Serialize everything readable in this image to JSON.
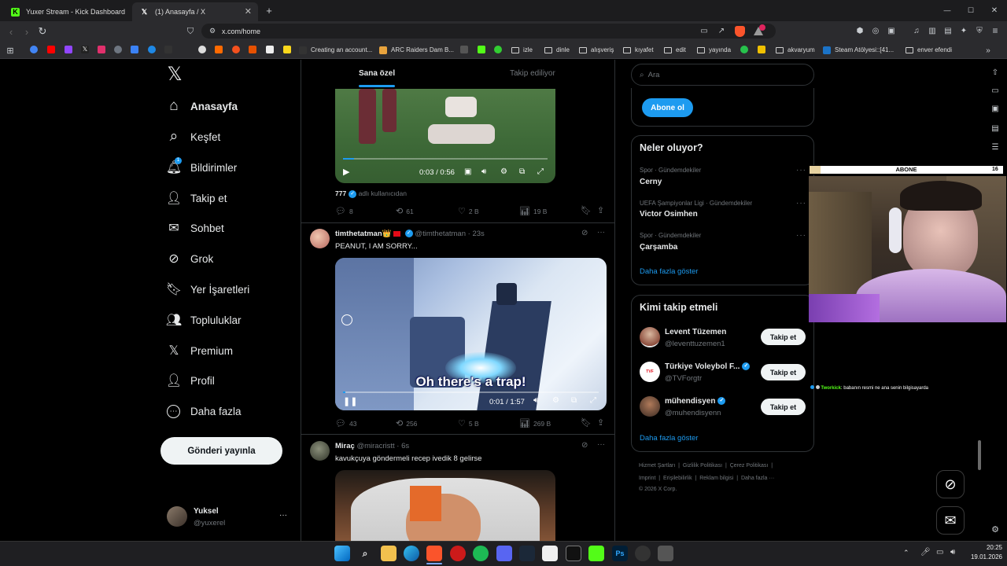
{
  "browser": {
    "tabs": [
      {
        "title": "Yuxer Stream - Kick Dashboard",
        "icon": "kick-icon",
        "color": "#53fc18"
      },
      {
        "title": "(1) Anasayfa / X",
        "icon": "x-logo-icon",
        "color": "#ffffff"
      }
    ],
    "new_tab": "+",
    "url": "x.com/home",
    "bookmarks": [
      {
        "label": "Creating an account...",
        "type": "page"
      },
      {
        "label": "ARC Raiders Dam B...",
        "type": "page"
      },
      {
        "label": "izle",
        "type": "folder"
      },
      {
        "label": "dinle",
        "type": "folder"
      },
      {
        "label": "alışveriş",
        "type": "folder"
      },
      {
        "label": "kıyafet",
        "type": "folder"
      },
      {
        "label": "edit",
        "type": "folder"
      },
      {
        "label": "yayında",
        "type": "folder"
      },
      {
        "label": "akvaryum",
        "type": "folder"
      },
      {
        "label": "Steam Atölyesi::[41...",
        "type": "page"
      },
      {
        "label": "enver efendi",
        "type": "folder"
      }
    ],
    "window_controls": [
      "—",
      "☐",
      "✕"
    ]
  },
  "sidebar": {
    "logo": "𝕏",
    "items": [
      {
        "label": "Anasayfa",
        "icon": "home-icon",
        "glyph": "⌂",
        "active": true
      },
      {
        "label": "Keşfet",
        "icon": "search-icon",
        "glyph": "⌕"
      },
      {
        "label": "Bildirimler",
        "icon": "bell-icon",
        "glyph": "🔔︎",
        "badge": "1"
      },
      {
        "label": "Takip et",
        "icon": "follow-icon",
        "glyph": "👤︎"
      },
      {
        "label": "Sohbet",
        "icon": "mail-icon",
        "glyph": "✉"
      },
      {
        "label": "Grok",
        "icon": "grok-icon",
        "glyph": "⊘"
      },
      {
        "label": "Yer İşaretleri",
        "icon": "bookmark-icon",
        "glyph": "🔖︎"
      },
      {
        "label": "Topluluklar",
        "icon": "communities-icon",
        "glyph": "👥︎"
      },
      {
        "label": "Premium",
        "icon": "premium-x-icon",
        "glyph": "𝕏"
      },
      {
        "label": "Profil",
        "icon": "profile-icon",
        "glyph": "👤︎"
      },
      {
        "label": "Daha fazla",
        "icon": "more-icon",
        "glyph": "⋯"
      }
    ],
    "post_button": "Gönderi yayınla",
    "account": {
      "name": "Yuksel",
      "handle": "@yuxerel",
      "more": "···"
    }
  },
  "timeline": {
    "tabs": [
      "Sana özel",
      "Takip ediliyor"
    ],
    "posts": [
      {
        "video_time": "0:03 / 0:56",
        "progress": 0.054,
        "attribution_name": "777",
        "attribution_text": "adlı kullanıcıdan",
        "metrics": {
          "replies": "8",
          "reposts": "61",
          "likes": "2 B",
          "views": "19 B"
        }
      },
      {
        "author": "timthetatman",
        "author_emoji": "👑",
        "handle": "@timthetatman",
        "time": "23s",
        "text": "PEANUT, I AM SORRY...",
        "video_caption": "Oh there's a trap!",
        "video_time": "0:01 / 1:57",
        "progress": 0.01,
        "metrics": {
          "replies": "43",
          "reposts": "256",
          "likes": "5 B",
          "views": "269 B"
        }
      },
      {
        "author": "Miraç",
        "handle": "@miracristt",
        "time": "6s",
        "text": "kavukçuya göndermeli recep ivedik 8 gelirse"
      }
    ]
  },
  "right": {
    "search_placeholder": "Ara",
    "subscribe_button": "Abone ol",
    "trends_title": "Neler oluyor?",
    "trends": [
      {
        "category": "Spor · Gündemdekiler",
        "name": "Cerny"
      },
      {
        "category": "UEFA Şampiyonlar Ligi · Gündemdekiler",
        "name": "Victor Osimhen"
      },
      {
        "category": "Spor · Gündemdekiler",
        "name": "Çarşamba"
      }
    ],
    "trends_more": "Daha fazla göster",
    "who_title": "Kimi takip etmeli",
    "who": [
      {
        "name": "Levent Tüzemen",
        "handle": "@leventtuzemen1",
        "button": "Takip et",
        "verified": false
      },
      {
        "name": "Türkiye Voleybol F...",
        "handle": "@TVForgtr",
        "button": "Takip et",
        "verified": true
      },
      {
        "name": "mühendisyen",
        "handle": "@muhendisyenn",
        "button": "Takip et",
        "verified": true
      }
    ],
    "who_more": "Daha fazla göster",
    "footer": [
      "Hizmet Şartları",
      "Gizlilik Politikası",
      "Çerez Politikası",
      "Imprint",
      "Erişilebilirlik",
      "Reklam bilgisi",
      "Daha fazla ···",
      "© 2026 X Corp."
    ]
  },
  "overlay": {
    "abone_label": "ABONE",
    "abone_count": "16",
    "chat_user": "Tworkick",
    "chat_message": ": babanın resmi ne ana senin bilgisayarda"
  },
  "taskbar": {
    "time": "20:25",
    "date": "19.01.2026"
  },
  "colors": {
    "accent": "#1d9bf0",
    "bg": "#000000",
    "border": "#2f3336",
    "muted": "#71767b"
  }
}
